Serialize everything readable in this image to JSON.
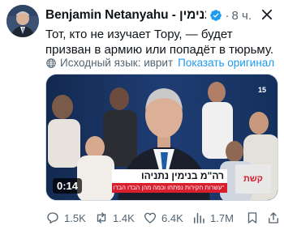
{
  "author": {
    "name": "Benjamin Netanyahu - בנימין...",
    "time": "8 ч."
  },
  "tweet": {
    "text": "Тот, кто не изучает Тору, — будет призван в армию или попадёт в тюрьму.",
    "source_language": "Исходный язык: иврит",
    "show_original": "Показать оригинал"
  },
  "media": {
    "duration": "0:14",
    "lower_third_title": "רה\"מ בנימין נתניהו",
    "lower_third_sub": "\"עשרות חקירות נפתחו וכמה מהן הבדו הבדו דברים - אבל לא מתלונות\"",
    "channel": "קשת",
    "corner_mark": "15"
  },
  "actions": {
    "replies": "1.5K",
    "reposts": "1.4K",
    "likes": "6.4K",
    "views": "1.7M"
  },
  "colors": {
    "accent": "#1d9bf0",
    "muted": "#536471",
    "text": "#0f1419"
  }
}
